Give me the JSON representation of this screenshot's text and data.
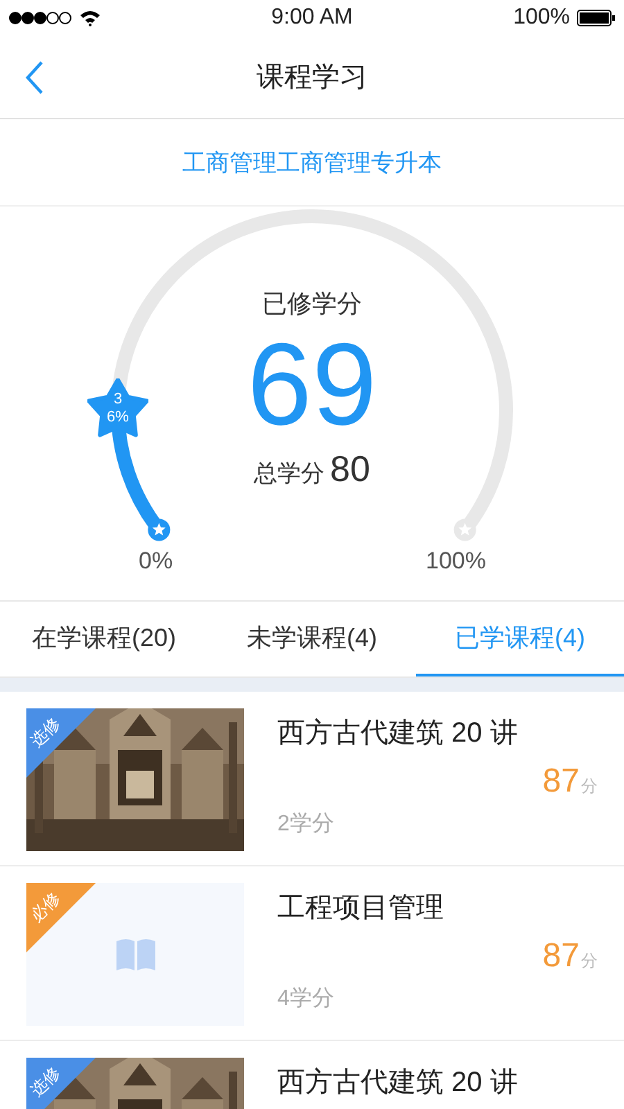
{
  "status_bar": {
    "time": "9:00 AM",
    "battery": "100%"
  },
  "nav": {
    "title": "课程学习"
  },
  "major": "工商管理工商管理专升本",
  "gauge": {
    "caption": "已修学分",
    "earned": "69",
    "total_label": "总学分",
    "total": "80",
    "level": 0.15,
    "reading": "36%",
    "min_label": "0%",
    "max_label": "100%"
  },
  "tabs": [
    {
      "label": "在学课程(20)",
      "selected": false
    },
    {
      "label": "未学课程(4)",
      "selected": false
    },
    {
      "label": "已学课程(4)",
      "selected": true
    }
  ],
  "courses": [
    {
      "tag": "选修",
      "color": "#4a8fe6",
      "kind": "picture",
      "title": "西方古代建筑 20 讲",
      "score": "87",
      "score_unit": "分",
      "credits": "2学分"
    },
    {
      "tag": "必修",
      "color": "#f39a3a",
      "kind": "placeholder",
      "title": "工程项目管理",
      "score": "87",
      "score_unit": "分",
      "credits": "4学分"
    },
    {
      "tag": "选修",
      "color": "#4a8fe6",
      "kind": "picture",
      "title": "西方古代建筑 20 讲"
    }
  ]
}
